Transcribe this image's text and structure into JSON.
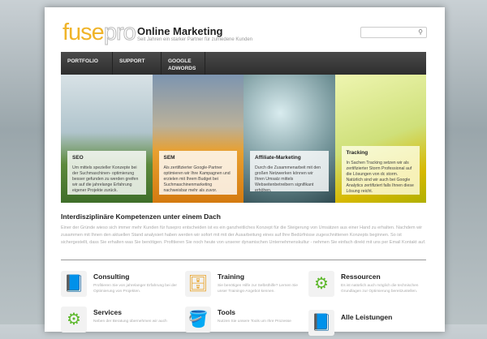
{
  "header": {
    "logo_main": "fuse",
    "logo_accent": "pro",
    "title": "Online Marketing",
    "tagline": "Seit Jahren ein starker Partner für zufriedene Kunden",
    "search_placeholder": ""
  },
  "nav": [
    "PORTFOLIO",
    "SUPPORT",
    "GOOGLE ADWORDS"
  ],
  "banner": [
    {
      "title": "SEO",
      "text": "Um mittels spezieller Konzepte bei der Suchmaschinen- optimierung besser gefunden zu werden greifen wir auf die jahrelange Erfahrung eigener Projekte zurück."
    },
    {
      "title": "SEM",
      "text": "Als zertifizierter Google-Partner optimieren wir Ihre Kampagnen und erzielen mit Ihrem Budget bei Suchmaschinenmarketing nachweisbar mehr als zuvor."
    },
    {
      "title": "Affiliate-Marketing",
      "text": "Durch die Zusammenarbeit mit den großen Netzwerken können wir Ihren Umsatz mittels Webseitenbetreibern signifikant erhöhen."
    },
    {
      "title": "Tracking",
      "text": "In Sachen Tracking setzen wir als zertifizierter Storm Professional auf die Lösungen von dc storm. Natürlich sind wir auch bei Google Analytics zertifiziert falls Ihnen diese Lösung reicht."
    }
  ],
  "intro": {
    "heading": "Interdisziplinäre Kompetenzen unter einem Dach",
    "text": "Einer der Gründe wieso sich immer mehr Kunden für fusepro entscheiden ist es ein ganzheitliches Konzept für die Steigerung von Umsätzen aus einer Hand zu erhalten. Nachdem wir zusammen mit Ihnen den aktuellen Stand analysiert haben werden wir sofort mit mit der Ausarbeitung eines auf Ihre Bedürfnisse zugeschnittenen Konzepts beginnen. So ist sichergestellt, dass Sie erhalten was Sie benötigen. Profitieren Sie noch heute von unserer dynamischen Unternehmenskultur - nehmen Sie einfach direkt mit uns per Email Kontakt auf."
  },
  "services": [
    {
      "title": "Consulting",
      "text": "Profitieren Sie von jahrelanger Erfahrung bei der Optimierung von Projekten.",
      "icon": "book-globe-icon"
    },
    {
      "title": "Training",
      "text": "Sie benötigen Hilfe zur Selbsthilfe? Lernen Sie unser Trainings-Angebot kennen.",
      "icon": "drawer-icon"
    },
    {
      "title": "Ressourcen",
      "text": "Es ist natürlich auch möglich die technischen Grundlagen zur Optimierung bereitzustellen.",
      "icon": "gear-icon"
    },
    {
      "title": "Services",
      "text": "Neben der Beratung übernehmen wir auch",
      "icon": "gear-icon"
    },
    {
      "title": "Tools",
      "text": "Nutzen Sie unsere Tools um Ihre Prozesse",
      "icon": "paint-bucket-icon"
    },
    {
      "title": "Alle Leistungen",
      "text": "",
      "icon": "book-globe-icon"
    }
  ]
}
